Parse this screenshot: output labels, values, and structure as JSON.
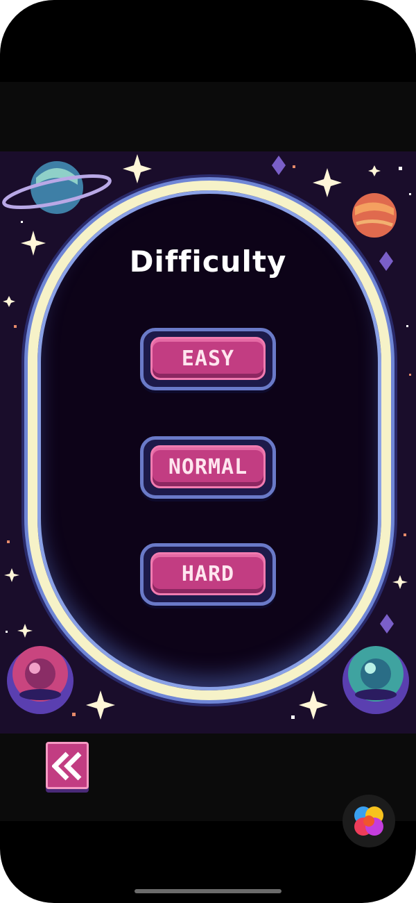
{
  "screen": {
    "title": "Difficulty"
  },
  "difficulty_options": [
    {
      "label": "EASY"
    },
    {
      "label": "NORMAL"
    },
    {
      "label": "HARD"
    }
  ],
  "icons": {
    "back": "chevron-left-icon",
    "app_badge": "multicolor-circles-icon"
  },
  "colors": {
    "background": "#1a0d2b",
    "frame": "#f6f2c8",
    "button_face": "#c23d82",
    "button_border": "#6a7ac8",
    "title_text": "#ffffff"
  }
}
